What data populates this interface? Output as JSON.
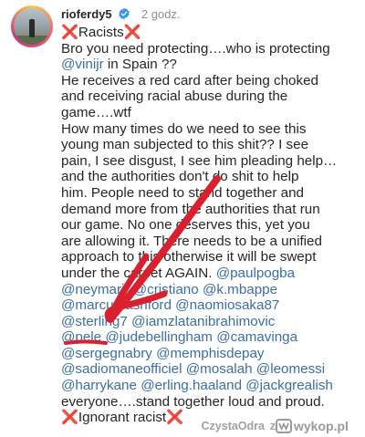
{
  "post": {
    "username": "rioferdy5",
    "time": "2 godz.",
    "caption_lines": [
      [
        {
          "t": "❌",
          "x": true
        },
        {
          "t": "Racists"
        },
        {
          "t": "❌",
          "x": true
        }
      ],
      [
        {
          "t": "Bro you need protecting….who is protecting"
        }
      ],
      [
        {
          "t": "@vinijr",
          "m": true
        },
        {
          "t": " in Spain ??"
        }
      ],
      [
        {
          "t": "He receives a red card after being choked"
        }
      ],
      [
        {
          "t": "and receiving racial abuse during the"
        }
      ],
      [
        {
          "t": "game….wtf"
        }
      ],
      [
        {
          "t": "How many times do we need to see this"
        }
      ],
      [
        {
          "t": "young man subjected to this shit?? I see"
        }
      ],
      [
        {
          "t": "pain, I see disgust, I see him pleading help…"
        }
      ],
      [
        {
          "t": "and the authorities don't do shit to help"
        }
      ],
      [
        {
          "t": "him. People need to stand together and"
        }
      ],
      [
        {
          "t": "demand more from the authorities that run"
        }
      ],
      [
        {
          "t": "our game. No one deserves this, yet you"
        }
      ],
      [
        {
          "t": "are allowing it. There needs to be a unified"
        }
      ],
      [
        {
          "t": "approach to this otherwise it will be swept"
        }
      ],
      [
        {
          "t": "under the carpet AGAIN. "
        },
        {
          "t": "@paulpogba",
          "m": true
        }
      ],
      [
        {
          "t": "@neymarjr",
          "m": true
        },
        {
          "t": " "
        },
        {
          "t": "@cristiano",
          "m": true
        },
        {
          "t": " "
        },
        {
          "t": "@k.mbappe",
          "m": true
        }
      ],
      [
        {
          "t": "@marcusrashford",
          "m": true
        },
        {
          "t": " "
        },
        {
          "t": "@naomiosaka87",
          "m": true
        }
      ],
      [
        {
          "t": "@sterling7",
          "m": true
        },
        {
          "t": " "
        },
        {
          "t": "@iamzlatanibrahimovic",
          "m": true
        }
      ],
      [
        {
          "t": "@pele",
          "m": true
        },
        {
          "t": " "
        },
        {
          "t": "@judebellingham",
          "m": true
        },
        {
          "t": " "
        },
        {
          "t": "@camavinga",
          "m": true
        }
      ],
      [
        {
          "t": "@sergegnabry",
          "m": true
        },
        {
          "t": " "
        },
        {
          "t": "@memphisdepay",
          "m": true
        }
      ],
      [
        {
          "t": "@sadiomaneofficiel",
          "m": true
        },
        {
          "t": " "
        },
        {
          "t": "@mosalah",
          "m": true
        },
        {
          "t": " "
        },
        {
          "t": "@leomessi",
          "m": true
        }
      ],
      [
        {
          "t": "@harrykane",
          "m": true
        },
        {
          "t": " "
        },
        {
          "t": "@erling.haaland",
          "m": true
        },
        {
          "t": " "
        },
        {
          "t": "@jackgrealish",
          "m": true
        }
      ],
      [
        {
          "t": "everyone….stand together loud and proud."
        }
      ],
      [
        {
          "t": "❌",
          "x": true
        },
        {
          "t": "Ignorant racist"
        },
        {
          "t": "❌",
          "x": true
        }
      ]
    ]
  },
  "watermark": {
    "user": "CzystaOdra",
    "z": "z",
    "site": "wykop.pl"
  },
  "colors": {
    "mention": "#3b6ea8",
    "annotation_red": "#d8202f",
    "x_mark": "#d63a3a"
  },
  "icons": [
    "avatar-image",
    "verified-badge-icon",
    "red-arrow-annotation",
    "wykop-logo-icon"
  ]
}
